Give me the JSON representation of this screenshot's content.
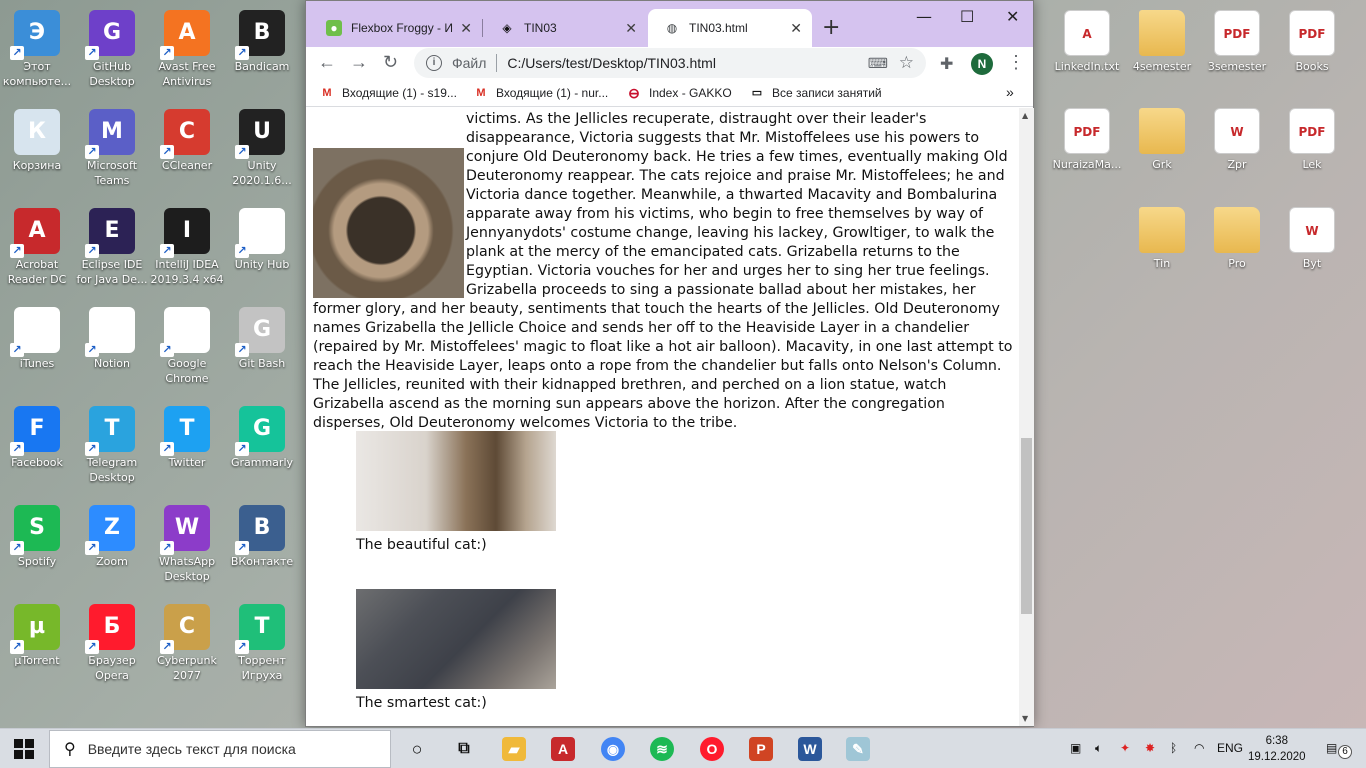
{
  "desktop": {
    "left_icons": [
      {
        "label": "Этот компьюте...",
        "icon": "computer-icon",
        "color": "#3b8ed8"
      },
      {
        "label": "GitHub Desktop",
        "icon": "github-icon",
        "color": "#6e40c9"
      },
      {
        "label": "Avast Free Antivirus",
        "icon": "avast-icon",
        "color": "#f47321"
      },
      {
        "label": "Bandicam",
        "icon": "bandicam-icon",
        "color": "#222222"
      },
      {
        "label": "Корзина",
        "icon": "recycle-bin-icon",
        "color": "#d7e4ee"
      },
      {
        "label": "Microsoft Teams",
        "icon": "teams-icon",
        "color": "#5b5fc7"
      },
      {
        "label": "CCleaner",
        "icon": "ccleaner-icon",
        "color": "#d63b2f"
      },
      {
        "label": "Unity 2020.1.6...",
        "icon": "unity-icon",
        "color": "#222222"
      },
      {
        "label": "Acrobat Reader DC",
        "icon": "acrobat-icon",
        "color": "#c7292c"
      },
      {
        "label": "Eclipse IDE for Java De...",
        "icon": "eclipse-icon",
        "color": "#2c2255"
      },
      {
        "label": "IntelliJ IDEA 2019.3.4 x64",
        "icon": "intellij-icon",
        "color": "#1d1d1d"
      },
      {
        "label": "Unity Hub",
        "icon": "unity-hub-icon",
        "color": "#ffffff"
      },
      {
        "label": "iTunes",
        "icon": "itunes-icon",
        "color": "#ffffff"
      },
      {
        "label": "Notion",
        "icon": "notion-icon",
        "color": "#ffffff"
      },
      {
        "label": "Google Chrome",
        "icon": "chrome-icon",
        "color": "#ffffff"
      },
      {
        "label": "Git Bash",
        "icon": "git-bash-icon",
        "color": "#c3c3c3"
      },
      {
        "label": "Facebook",
        "icon": "facebook-icon",
        "color": "#1877f2"
      },
      {
        "label": "Telegram Desktop",
        "icon": "telegram-icon",
        "color": "#2aa3de"
      },
      {
        "label": "Twitter",
        "icon": "twitter-icon",
        "color": "#1da1f2"
      },
      {
        "label": "Grammarly",
        "icon": "grammarly-icon",
        "color": "#15c39a"
      },
      {
        "label": "Spotify",
        "icon": "spotify-icon",
        "color": "#1db954"
      },
      {
        "label": "Zoom",
        "icon": "zoom-icon",
        "color": "#2d8cff"
      },
      {
        "label": "WhatsApp Desktop",
        "icon": "whatsapp-icon",
        "color": "#8c3cc9"
      },
      {
        "label": "ВКонтакте",
        "icon": "vk-icon",
        "color": "#3b5f8f"
      },
      {
        "label": "µTorrent",
        "icon": "utorrent-icon",
        "color": "#77b82a"
      },
      {
        "label": "Браузер Opera",
        "icon": "opera-icon",
        "color": "#ff1b2d"
      },
      {
        "label": "Cyberpunk 2077",
        "icon": "cyberpunk-icon",
        "color": "#caa04a"
      },
      {
        "label": "Торрент Игруха",
        "icon": "torrent-igruha-icon",
        "color": "#1fbf79"
      }
    ],
    "right_icons": [
      {
        "label": "LinkedIn.txt",
        "icon": "text-file-icon",
        "type": "doc",
        "glyph": "A"
      },
      {
        "label": "4semester",
        "icon": "folder-icon",
        "type": "folder",
        "glyph": ""
      },
      {
        "label": "3semester",
        "icon": "pdf-file-icon",
        "type": "doc",
        "glyph": "PDF"
      },
      {
        "label": "Books",
        "icon": "pdf-file-icon",
        "type": "doc",
        "glyph": "PDF"
      },
      {
        "label": "NuraizaMa...",
        "icon": "pdf-file-icon",
        "type": "doc",
        "glyph": "PDF"
      },
      {
        "label": "Grk",
        "icon": "folder-icon",
        "type": "folder",
        "glyph": ""
      },
      {
        "label": "Zpr",
        "icon": "word-file-icon",
        "type": "doc",
        "glyph": "W"
      },
      {
        "label": "Lek",
        "icon": "pdf-file-icon",
        "type": "doc",
        "glyph": "PDF"
      },
      {
        "label": "Tin",
        "icon": "folder-icon",
        "type": "folder",
        "glyph": ""
      },
      {
        "label": "Pro",
        "icon": "folder-icon",
        "type": "folder",
        "glyph": ""
      },
      {
        "label": "Byt",
        "icon": "word-file-icon",
        "type": "doc",
        "glyph": "W"
      }
    ]
  },
  "browser": {
    "tabs": [
      {
        "title": "Flexbox Froggy - И",
        "icon": "frog-icon"
      },
      {
        "title": "TIN03",
        "icon": "codepen-icon"
      },
      {
        "title": "TIN03.html",
        "icon": "globe-icon"
      }
    ],
    "address": {
      "scheme_label": "Файл",
      "url": "C:/Users/test/Desktop/TIN03.html"
    },
    "profile_initial": "N",
    "bookmarks": [
      {
        "label": "Входящие (1) - s19...",
        "icon": "gmail-icon"
      },
      {
        "label": "Входящие (1) - nur...",
        "icon": "gmail-icon"
      },
      {
        "label": "Index - GAKKO",
        "icon": "gakko-icon"
      },
      {
        "label": "Все записи занятий",
        "icon": "recordings-icon"
      }
    ]
  },
  "page": {
    "paragraph": "victims. As the Jellicles recuperate, distraught over their leader's disappearance, Victoria suggests that Mr. Mistoffelees use his powers to conjure Old Deuteronomy back. He tries a few times, eventually making Old Deuteronomy reappear. The cats rejoice and praise Mr. Mistoffelees; he and Victoria dance together. Meanwhile, a thwarted Macavity and Bombalurina apparate away from his victims, who begin to free themselves by way of Jennyanydots' costume change, leaving his lackey, Growltiger, to walk the plank at the mercy of the emancipated cats. Grizabella returns to the Egyptian. Victoria vouches for her and urges her to sing her true feelings. Grizabella proceeds to sing a passionate ballad about her mistakes, her former glory, and her beauty, sentiments that touch the hearts of the Jellicles. Old Deuteronomy names Grizabella the Jellicle Choice and sends her off to the Heaviside Layer in a chandelier (repaired by Mr. Mistoffelees' magic to float like a hot air balloon). Macavity, in one last attempt to reach the Heaviside Layer, leaps onto a rope from the chandelier but falls onto Nelson's Column. The Jellicles, reunited with their kidnapped brethren, and perched on a lion statue, watch Grizabella ascend as the morning sun appears above the horizon. After the congregation disperses, Old Deuteronomy welcomes Victoria to the tribe.",
    "figures": [
      {
        "caption": "The beautiful cat:)"
      },
      {
        "caption": "The smartest cat:)"
      }
    ]
  },
  "taskbar": {
    "search_placeholder": "Введите здесь текст для поиска",
    "language": "ENG",
    "time": "6:38",
    "date": "19.12.2020",
    "notification_count": "6"
  }
}
